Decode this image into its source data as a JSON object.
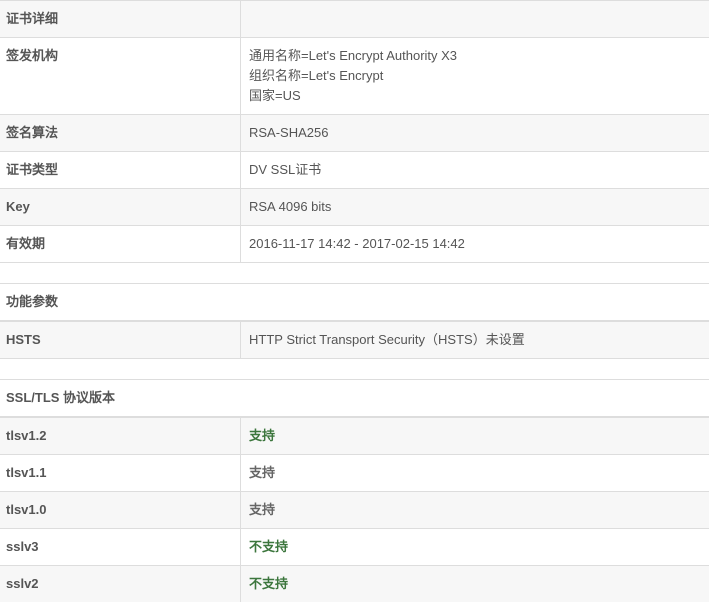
{
  "cert": {
    "title": "证书详细",
    "rows": [
      {
        "label": "签发机构",
        "lines": [
          "通用名称=Let's Encrypt Authority X3",
          "组织名称=Let's Encrypt",
          "国家=US"
        ]
      },
      {
        "label": "签名算法",
        "value": "RSA-SHA256"
      },
      {
        "label": "证书类型",
        "value": "DV SSL证书"
      },
      {
        "label": "Key",
        "value": "RSA 4096 bits"
      },
      {
        "label": "有效期",
        "value": "2016-11-17 14:42 - 2017-02-15 14:42"
      }
    ]
  },
  "features": {
    "title": "功能参数",
    "rows": [
      {
        "label": "HSTS",
        "value": "HTTP Strict Transport Security（HSTS）未设置"
      }
    ]
  },
  "protocols": {
    "title": "SSL/TLS 协议版本",
    "rows": [
      {
        "label": "tlsv1.2",
        "value": "支持",
        "status": "green"
      },
      {
        "label": "tlsv1.1",
        "value": "支持",
        "status": "plain"
      },
      {
        "label": "tlsv1.0",
        "value": "支持",
        "status": "plain"
      },
      {
        "label": "sslv3",
        "value": "不支持",
        "status": "green"
      },
      {
        "label": "sslv2",
        "value": "不支持",
        "status": "green"
      }
    ]
  },
  "colors": {
    "green": "#3c763d",
    "text": "#555555",
    "stripe": "#f7f7f7"
  }
}
